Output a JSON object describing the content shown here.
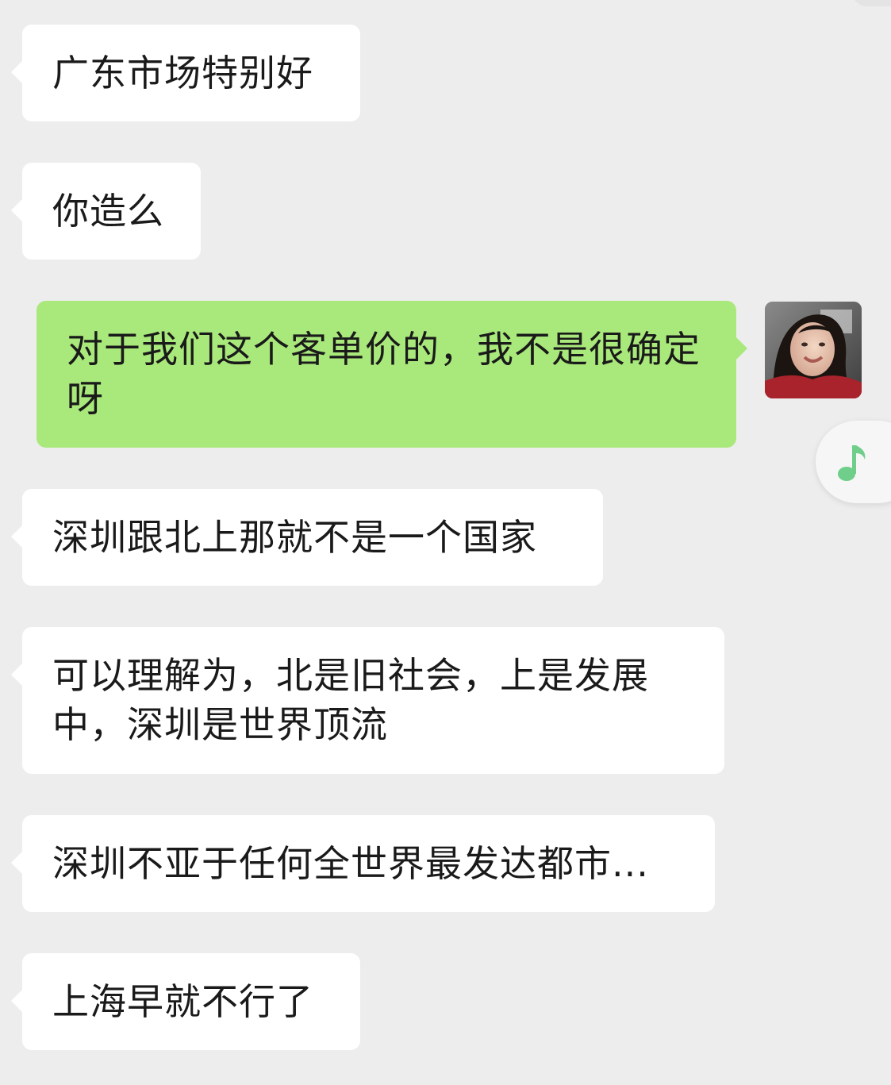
{
  "chat": {
    "messages": [
      {
        "direction": "in",
        "text": "广东市场特别好"
      },
      {
        "direction": "in",
        "text": "你造么"
      },
      {
        "direction": "out",
        "text": "对于我们这个客单价的，我不是很确定呀"
      },
      {
        "direction": "in",
        "text": "深圳跟北上那就不是一个国家"
      },
      {
        "direction": "in",
        "text": "可以理解为，北是旧社会，上是发展中，深圳是世界顶流"
      },
      {
        "direction": "in",
        "text": "深圳不亚于任何全世界最发达都市..."
      },
      {
        "direction": "in",
        "text": "上海早就不行了"
      }
    ]
  },
  "icons": {
    "music": "music-note-icon",
    "avatar": "user-avatar-photo"
  },
  "colors": {
    "background": "#ededed",
    "incoming_bubble": "#ffffff",
    "outgoing_bubble": "#a9e97b",
    "music_note": "#6fcf8a"
  }
}
